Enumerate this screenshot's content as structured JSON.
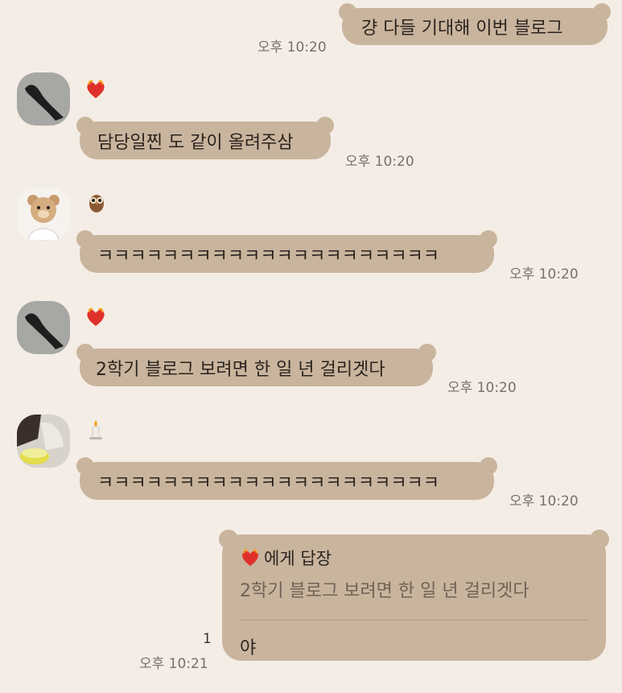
{
  "messages": [
    {
      "text": "걍 다들 기대해 이번 블로그",
      "time": "오후 10:20"
    },
    {
      "text": "담당일찐 도 같이 올려주삼",
      "time": "오후 10:20"
    },
    {
      "text": "ㅋㅋㅋㅋㅋㅋㅋㅋㅋㅋㅋㅋㅋㅋㅋㅋㅋㅋㅋㅋㅋ",
      "time": "오후 10:20"
    },
    {
      "text": "2학기 블로그 보려면 한 일 년 걸리겟다",
      "time": "오후 10:20"
    },
    {
      "text": "ㅋㅋㅋㅋㅋㅋㅋㅋㅋㅋㅋㅋㅋㅋㅋㅋㅋㅋㅋㅋㅋ",
      "time": "오후 10:20"
    }
  ],
  "reply": {
    "header": "에게 답장",
    "quote": "2학기 블로그 보려면 한 일 년 걸리겟다",
    "text": "야",
    "time": "오후 10:21",
    "unread": "1"
  },
  "icons": {
    "heart": "burning-heart-icon",
    "owl": "owl-icon",
    "candle": "candle-icon"
  },
  "colors": {
    "bubble": "#c9b49d",
    "background": "#f4ede5"
  }
}
